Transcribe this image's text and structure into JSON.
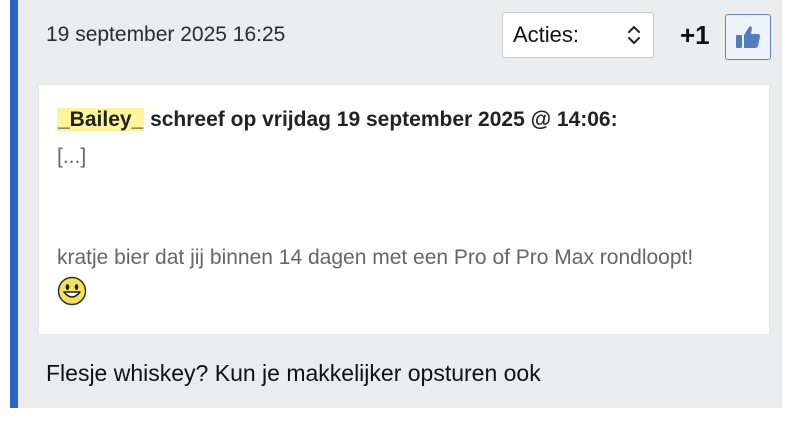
{
  "post": {
    "timestamp": "19 september 2025 16:25",
    "actions": {
      "selected": "Acties:",
      "icon": "chevron-updown-icon"
    },
    "score": "+1",
    "like_icon": "thumbs-up-icon",
    "quote": {
      "username": "_Bailey_",
      "header_suffix": "schreef op vrijdag 19 september 2025 @ 14:06:",
      "ellipsis": "[...]",
      "text": "kratje bier dat jij binnen 14 dagen met een Pro of Pro Max rondloopt!",
      "emoji_icon": "grinning-smiley-icon"
    },
    "reply": "Flesje whiskey? Kun je makkelijker opsturen ook"
  },
  "colors": {
    "accent_bar": "#2d64c6",
    "background": "#ebecee",
    "username_highlight": "#fcf59a",
    "like_button_border": "#5b86c6"
  }
}
